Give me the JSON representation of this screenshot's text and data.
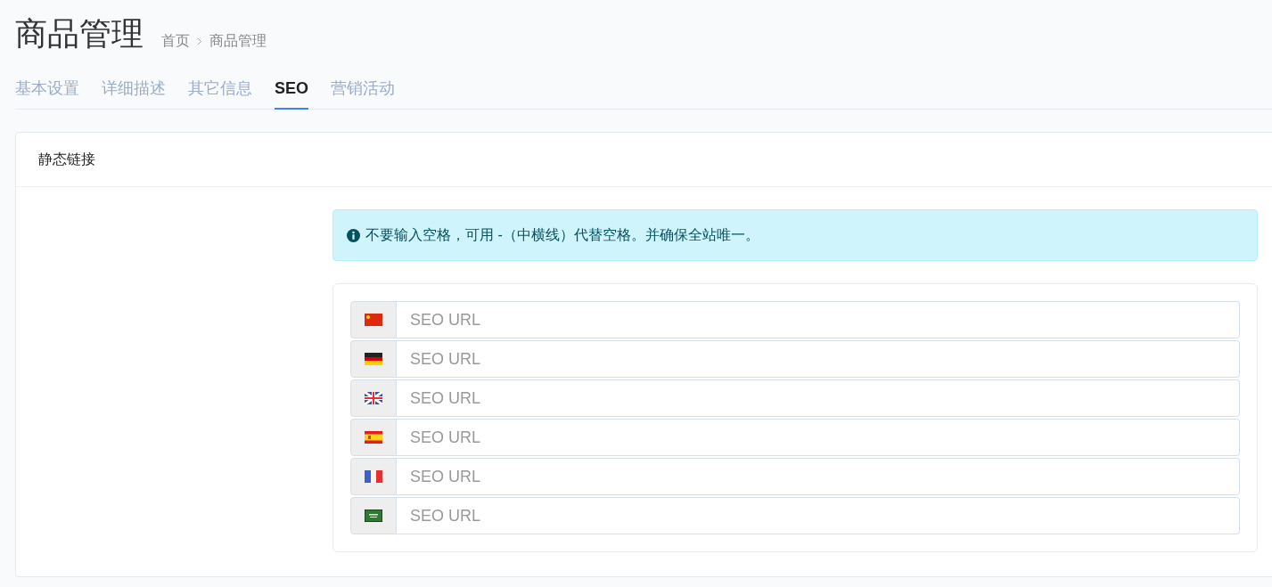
{
  "page": {
    "title": "商品管理",
    "breadcrumb": [
      {
        "label": "首页"
      },
      {
        "label": "商品管理"
      }
    ]
  },
  "tabs": [
    {
      "label": "基本设置",
      "selected": false
    },
    {
      "label": "详细描述",
      "selected": false
    },
    {
      "label": "其它信息",
      "selected": false
    },
    {
      "label": "SEO",
      "selected": true
    },
    {
      "label": "营销活动",
      "selected": false
    }
  ],
  "card": {
    "title": "静态链接",
    "alert": "不要输入空格，可用 -（中横线）代替空格。并确保全站唯一。",
    "fields": [
      {
        "kind": "cn",
        "placeholder": "SEO URL"
      },
      {
        "kind": "de",
        "placeholder": "SEO URL"
      },
      {
        "kind": "gb",
        "placeholder": "SEO URL"
      },
      {
        "kind": "es",
        "placeholder": "SEO URL"
      },
      {
        "kind": "fr",
        "placeholder": "SEO URL"
      },
      {
        "kind": "sa",
        "placeholder": "SEO URL"
      }
    ]
  }
}
